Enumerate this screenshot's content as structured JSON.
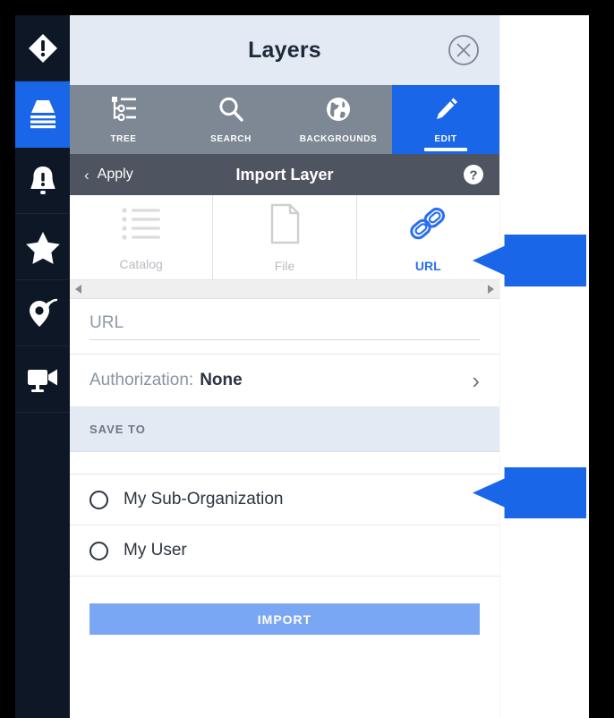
{
  "rail": {
    "items": [
      {
        "name": "alerts-diamond",
        "icon": "alert-diamond-icon",
        "active": false
      },
      {
        "name": "layers",
        "icon": "layers-icon",
        "active": true
      },
      {
        "name": "notifications",
        "icon": "bell-alert-icon",
        "active": false
      },
      {
        "name": "favorites",
        "icon": "star-icon",
        "active": false
      },
      {
        "name": "tracking",
        "icon": "location-signal-icon",
        "active": false
      },
      {
        "name": "video",
        "icon": "video-camera-icon",
        "active": false
      }
    ]
  },
  "panel": {
    "title": "Layers",
    "close_icon": "close-circle-icon"
  },
  "tabs": [
    {
      "label": "TREE",
      "icon": "tree-list-icon",
      "active": false
    },
    {
      "label": "SEARCH",
      "icon": "search-icon",
      "active": false
    },
    {
      "label": "BACKGROUNDS",
      "icon": "globe-icon",
      "active": false
    },
    {
      "label": "EDIT",
      "icon": "pencil-icon",
      "active": true
    }
  ],
  "subheader": {
    "back_label": "Apply",
    "back_icon": "chevron-left-icon",
    "title": "Import Layer",
    "help_icon": "help-circle-icon"
  },
  "source_tabs": [
    {
      "label": "Catalog",
      "icon": "bullet-list-icon",
      "active": false
    },
    {
      "label": "File",
      "icon": "document-icon",
      "active": false
    },
    {
      "label": "URL",
      "icon": "chain-link-icon",
      "active": true
    }
  ],
  "scrollbar": {
    "left_icon": "scroll-left-arrow-icon",
    "right_icon": "scroll-right-arrow-icon"
  },
  "form": {
    "url_placeholder": "URL",
    "url_value": "",
    "authorization_label": "Authorization:",
    "authorization_value": "None",
    "authorization_chevron_icon": "chevron-right-icon",
    "save_to_heading": "SAVE TO",
    "save_to_options": [
      {
        "label": "My Sub-Organization",
        "selected": false
      },
      {
        "label": "My User",
        "selected": false
      }
    ],
    "import_button": "IMPORT"
  },
  "colors": {
    "accent_blue": "#1a66e8",
    "rail_dark": "#0d1726",
    "title_bar": "#e3eaf3",
    "tabstrip_gray": "#7e8894",
    "subheader_gray": "#4e5561",
    "import_button": "#7aa7f3",
    "link_blue": "#2a6ff0",
    "muted_text": "#b9bcc2"
  },
  "annotations": [
    {
      "name": "url-tab-callout",
      "shape": "left-arrow",
      "color": "#1a66e8"
    },
    {
      "name": "save-to-callout",
      "shape": "left-arrow",
      "color": "#1a66e8"
    }
  ]
}
